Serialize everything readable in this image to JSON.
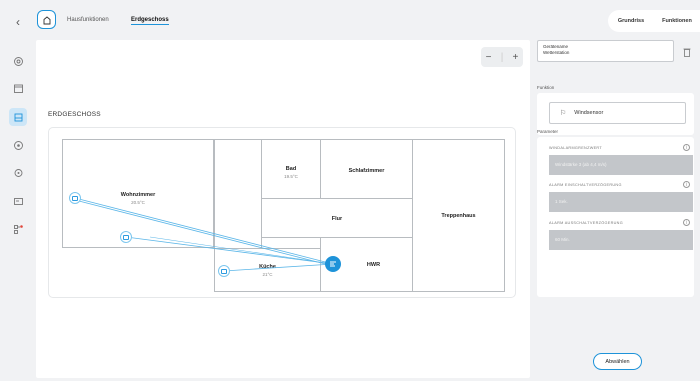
{
  "header": {
    "breadcrumb": [
      "Hausfunktionen",
      "Erdgeschoss"
    ],
    "view_tabs": [
      "Grundriss",
      "Funktionen"
    ]
  },
  "sidebar": {
    "items": [
      {
        "icon": "settings-icon"
      },
      {
        "icon": "calendar-icon"
      },
      {
        "icon": "floorplan-icon",
        "active": true
      },
      {
        "icon": "compass-icon"
      },
      {
        "icon": "location-icon"
      },
      {
        "icon": "display-icon"
      },
      {
        "icon": "network-icon"
      }
    ]
  },
  "canvas": {
    "zoom_out": "−",
    "zoom_in": "+",
    "floor_label": "ERDGESCHOSS",
    "rooms": [
      {
        "name": "Wohnzimmer",
        "temp": "20.5°C"
      },
      {
        "name": "Bad",
        "temp": "19.5°C"
      },
      {
        "name": "Schlafzimmer",
        "temp": ""
      },
      {
        "name": "Flur",
        "temp": ""
      },
      {
        "name": "Treppenhaus",
        "temp": ""
      },
      {
        "name": "HWR",
        "temp": ""
      },
      {
        "name": "Küche",
        "temp": "21°C"
      }
    ]
  },
  "panel": {
    "selected_label": "Gerätename",
    "selected_value": "Wetterstation",
    "function_heading": "Funktion",
    "function_value": "Windsensor",
    "params_heading": "Parameter",
    "params": [
      {
        "label": "WINDALARMGRENZWERT",
        "value": "Windstärke 3 (ab 4,4 m/s)"
      },
      {
        "label": "ALARM EINSCHALTVERZÖGERUNG",
        "value": "1 Sek."
      },
      {
        "label": "ALARM AUSSCHALTVERZÖGERUNG",
        "value": "60 Min."
      }
    ],
    "deselect_button": "Abwählen"
  },
  "colors": {
    "accent": "#1e93d9",
    "background": "#f1f2f4",
    "field": "#c3c6ca"
  }
}
